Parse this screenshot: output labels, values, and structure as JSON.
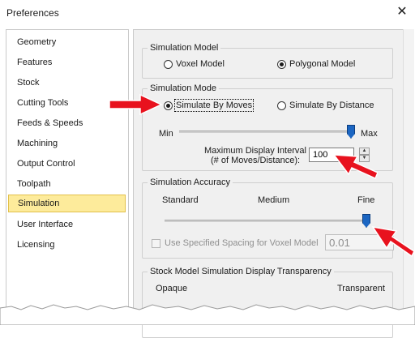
{
  "window": {
    "title": "Preferences",
    "close_icon": "close-icon"
  },
  "sidebar": {
    "items": [
      {
        "label": "Geometry"
      },
      {
        "label": "Features"
      },
      {
        "label": "Stock"
      },
      {
        "label": "Cutting Tools"
      },
      {
        "label": "Feeds & Speeds"
      },
      {
        "label": "Machining"
      },
      {
        "label": "Output Control"
      },
      {
        "label": "Toolpath"
      },
      {
        "label": "Simulation",
        "selected": true
      },
      {
        "label": "User Interface"
      },
      {
        "label": "Licensing"
      }
    ]
  },
  "simulation_model": {
    "title": "Simulation Model",
    "options": [
      {
        "label": "Voxel Model",
        "checked": false
      },
      {
        "label": "Polygonal Model",
        "checked": true
      }
    ]
  },
  "simulation_mode": {
    "title": "Simulation Mode",
    "options": [
      {
        "label": "Simulate By Moves",
        "checked": true
      },
      {
        "label": "Simulate By Distance",
        "checked": false
      }
    ],
    "slider": {
      "min_label": "Min",
      "max_label": "Max",
      "level": 1.0
    },
    "interval": {
      "label_line1": "Maximum Display Interval",
      "label_line2": "(# of Moves/Distance):",
      "value": "100"
    }
  },
  "simulation_accuracy": {
    "title": "Simulation Accuracy",
    "labels": {
      "standard": "Standard",
      "medium": "Medium",
      "fine": "Fine"
    },
    "slider": {
      "level": 1.0
    },
    "spacing": {
      "label": "Use Specified Spacing for Voxel Model",
      "checked": false,
      "enabled": false,
      "value": "0.01"
    }
  },
  "transparency": {
    "title": "Stock Model Simulation Display Transparency",
    "labels": {
      "opaque": "Opaque",
      "transparent": "Transparent"
    }
  },
  "colors": {
    "accent": "#1c66c2",
    "selected_bg": "#fdeb9b",
    "annotation": "#e8121e"
  }
}
